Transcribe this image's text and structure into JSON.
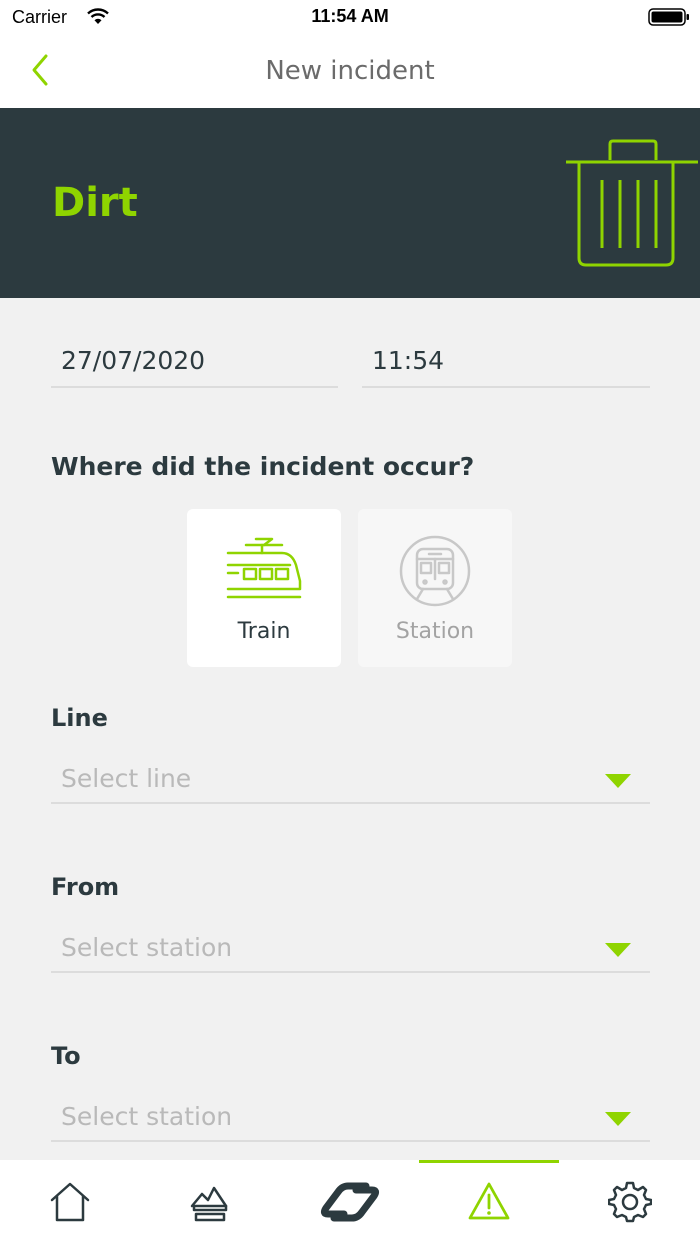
{
  "status_bar": {
    "carrier": "Carrier",
    "time": "11:54 AM"
  },
  "nav": {
    "title": "New incident",
    "back_icon": "chevron-left-icon"
  },
  "hero": {
    "title": "Dirt",
    "icon": "trash-icon"
  },
  "form": {
    "date": "27/07/2020",
    "time": "11:54",
    "location_question": "Where did the incident occur?",
    "location_options": [
      {
        "label": "Train",
        "icon": "train-icon",
        "selected": true
      },
      {
        "label": "Station",
        "icon": "station-icon",
        "selected": false
      }
    ],
    "line": {
      "label": "Line",
      "placeholder": "Select line"
    },
    "from": {
      "label": "From",
      "placeholder": "Select station"
    },
    "to": {
      "label": "To",
      "placeholder": "Select station"
    }
  },
  "tabbar": {
    "items": [
      {
        "icon": "home-icon",
        "active": false
      },
      {
        "icon": "lost-items-icon",
        "active": false
      },
      {
        "icon": "logo-link-icon",
        "active": false
      },
      {
        "icon": "warning-icon",
        "active": true
      },
      {
        "icon": "gear-icon",
        "active": false
      }
    ]
  },
  "colors": {
    "accent": "#8fd400",
    "dark": "#2c3a3f",
    "background": "#f1f1f1",
    "placeholder": "#b9b9b9"
  }
}
